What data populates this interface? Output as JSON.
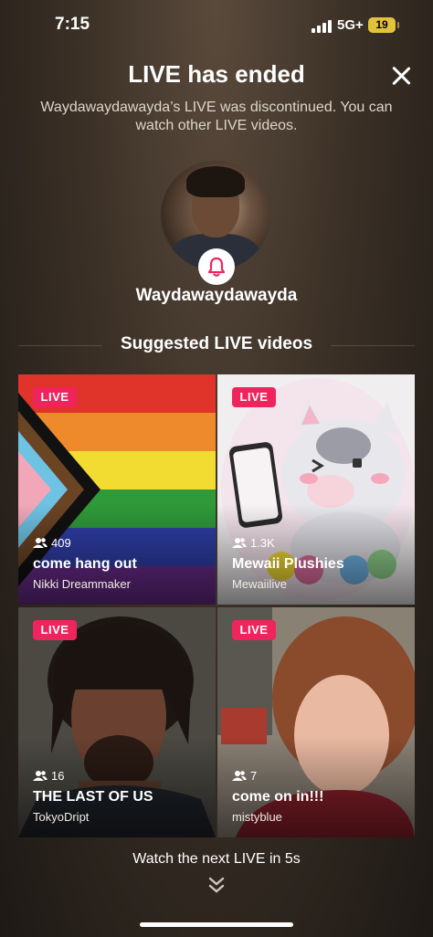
{
  "status_bar": {
    "time": "7:15",
    "network": "5G+",
    "battery": "19"
  },
  "header": {
    "title": "LIVE has ended",
    "subtitle": "Waydawaydawayda’s LIVE was discontinued. You can watch other LIVE videos."
  },
  "host": {
    "username": "Waydawaydawayda"
  },
  "suggested": {
    "heading": "Suggested LIVE videos",
    "cards": [
      {
        "badge": "LIVE",
        "viewers": "409",
        "title": "come hang out",
        "host": "Nikki Dreammaker"
      },
      {
        "badge": "LIVE",
        "viewers": "1.3K",
        "title": "Mewaii Plushies",
        "host": "Mewaiilive"
      },
      {
        "badge": "LIVE",
        "viewers": "16",
        "title": "THE LAST OF US",
        "host": "TokyoDript"
      },
      {
        "badge": "LIVE",
        "viewers": "7",
        "title": "come on in!!!",
        "host": "mistyblue"
      }
    ]
  },
  "footer": {
    "next_text": "Watch the next LIVE in 5s"
  },
  "colors": {
    "live_badge": "#f0245d",
    "accent": "#f0245d",
    "battery": "#e3c23b"
  },
  "icons": [
    "signal-icon",
    "battery-icon",
    "close-icon",
    "bell-icon",
    "viewers-icon",
    "double-chevron-down-icon"
  ]
}
